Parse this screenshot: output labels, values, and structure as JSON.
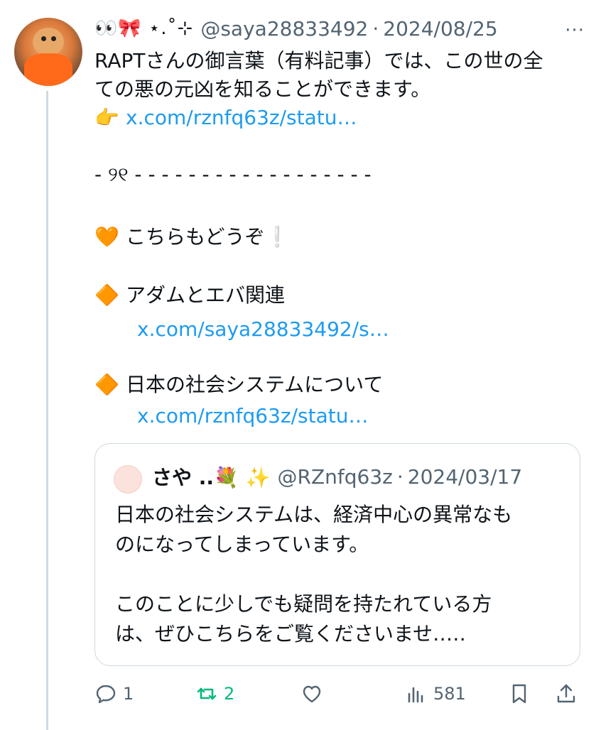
{
  "tweet": {
    "display_name": "👀🎀 ⋆.˚⊹",
    "handle": "@saya28833492",
    "separator": "·",
    "date": "2024/08/25",
    "more": "···",
    "line1": "RAPTさんの御言葉（有料記事）では、この世の全",
    "line2": "ての悪の元凶を知ることができます。",
    "link1_emoji": "👉",
    "link1": "x.com/rznfq63z/statu…",
    "divider": "- ୨୧ - - - - - - - - - - - - - - - - - -",
    "heading_emoji": "🧡",
    "heading": "こちらもどうぞ❕",
    "item1_emoji": "🔶",
    "item1": "アダムとエバ関連",
    "item1_link": "x.com/saya28833492/s…",
    "item2_emoji": "🔶",
    "item2": "日本の社会システムについて",
    "item2_link": "x.com/rznfq63z/statu…"
  },
  "quote": {
    "display_name": "さや ..💐 ✨",
    "handle": "@RZnfq63z",
    "separator": "·",
    "date": "2024/03/17",
    "line1": "日本の社会システムは、経済中心の異常なも",
    "line2": "のになってしまっています。",
    "line3": "このことに少しでも疑問を持たれている方",
    "line4": "は、ぜひこちらをご覧くださいませ‥…"
  },
  "actions": {
    "reply_count": "1",
    "retweet_count": "2",
    "views_count": "581"
  },
  "colors": {
    "link": "#1d9bf0",
    "muted": "#536471",
    "retweet_active": "#00ba7c"
  }
}
